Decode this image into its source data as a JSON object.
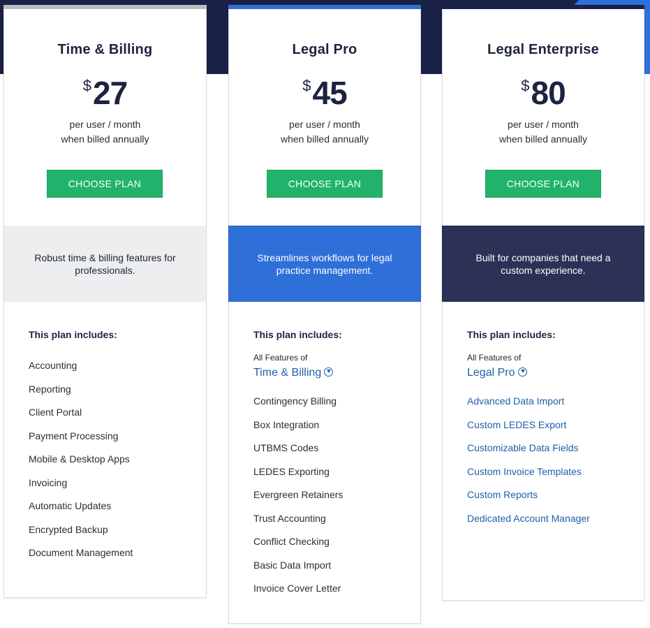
{
  "plans": [
    {
      "name": "Time & Billing",
      "currency": "$",
      "price": "27",
      "billing_line1": "per user / month",
      "billing_line2": "when billed annually",
      "button_label": "CHOOSE PLAN",
      "tagline": "Robust time & billing features for professionals.",
      "includes_title": "This plan includes:",
      "features": [
        "Accounting",
        "Reporting",
        "Client Portal",
        "Payment Processing",
        "Mobile & Desktop Apps",
        "Invoicing",
        "Automatic Updates",
        "Encrypted Backup",
        "Document Management"
      ]
    },
    {
      "name": "Legal Pro",
      "currency": "$",
      "price": "45",
      "billing_line1": "per user / month",
      "billing_line2": "when billed annually",
      "button_label": "CHOOSE PLAN",
      "tagline": "Streamlines workflows for legal practice management.",
      "includes_title": "This plan includes:",
      "all_features_label": "All Features of",
      "all_features_link": "Time & Billing",
      "features": [
        "Contingency Billing",
        "Box Integration",
        "UTBMS Codes",
        "LEDES Exporting",
        "Evergreen Retainers",
        "Trust Accounting",
        "Conflict Checking",
        "Basic Data Import",
        "Invoice Cover Letter"
      ]
    },
    {
      "name": "Legal Enterprise",
      "currency": "$",
      "price": "80",
      "billing_line1": "per user / month",
      "billing_line2": "when billed annually",
      "button_label": "CHOOSE PLAN",
      "tagline": "Built for companies that need a custom experience.",
      "includes_title": "This plan includes:",
      "all_features_label": "All Features of",
      "all_features_link": "Legal Pro",
      "features": [
        "Advanced Data Import",
        "Custom LEDES Export",
        "Customizable Data Fields",
        "Custom Invoice Templates",
        "Custom Reports",
        "Dedicated Account Manager"
      ]
    }
  ],
  "colors": {
    "navy": "#1a2147",
    "blue": "#2f6fd8",
    "green_button": "#21b36b",
    "link": "#1e5fa8",
    "gray_band": "#eceef0"
  }
}
